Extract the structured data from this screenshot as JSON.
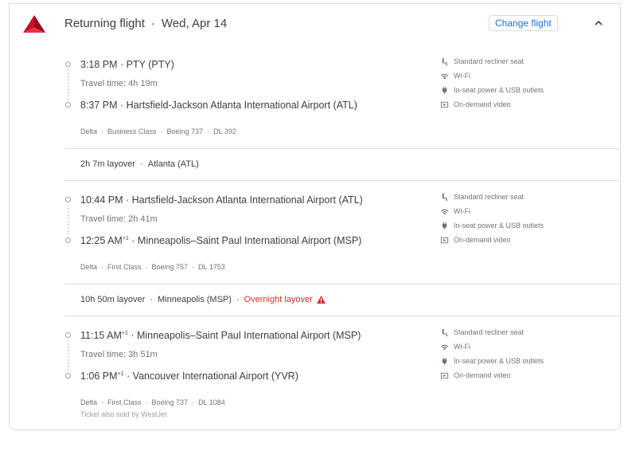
{
  "header": {
    "title": "Returning flight",
    "date": "Wed, Apr 14",
    "change_label": "Change flight"
  },
  "amenities": [
    {
      "icon": "seat-icon",
      "label": "Standard recliner seat"
    },
    {
      "icon": "wifi-icon",
      "label": "Wi-Fi"
    },
    {
      "icon": "power-icon",
      "label": "In-seat power & USB outlets"
    },
    {
      "icon": "video-icon",
      "label": "On-demand video"
    }
  ],
  "legs": [
    {
      "dep_time": "3:18 PM",
      "dep_sup": "",
      "dep_airport": "PTY (PTY)",
      "travel": "Travel time: 4h 19m",
      "arr_time": "8:37 PM",
      "arr_sup": "",
      "arr_airport": "Hartsfield-Jackson Atlanta International Airport (ATL)",
      "meta": [
        "Delta",
        "Business Class",
        "Boeing 737",
        "DL 392"
      ]
    },
    {
      "dep_time": "10:44 PM",
      "dep_sup": "",
      "dep_airport": "Hartsfield-Jackson Atlanta International Airport (ATL)",
      "travel": "Travel time: 2h 41m",
      "arr_time": "12:25 AM",
      "arr_sup": "+1",
      "arr_airport": "Minneapolis–Saint Paul International Airport (MSP)",
      "meta": [
        "Delta",
        "First Class",
        "Boeing 757",
        "DL 1753"
      ]
    },
    {
      "dep_time": "11:15 AM",
      "dep_sup": "+1",
      "dep_airport": "Minneapolis–Saint Paul International Airport (MSP)",
      "travel": "Travel time: 3h 51m",
      "arr_time": "1:06 PM",
      "arr_sup": "+1",
      "arr_airport": "Vancouver International Airport (YVR)",
      "meta": [
        "Delta",
        "First Class",
        "Boeing 737",
        "DL 1084"
      ],
      "sold_by": "Ticket also sold by WestJet"
    }
  ],
  "layovers": [
    {
      "duration": "2h 7m layover",
      "place": "Atlanta (ATL)",
      "warning": ""
    },
    {
      "duration": "10h 50m layover",
      "place": "Minneapolis (MSP)",
      "warning": "Overnight layover"
    }
  ],
  "colors": {
    "accent": "#1a73e8",
    "warning": "#d93025",
    "delta_red": "#c8102e"
  }
}
